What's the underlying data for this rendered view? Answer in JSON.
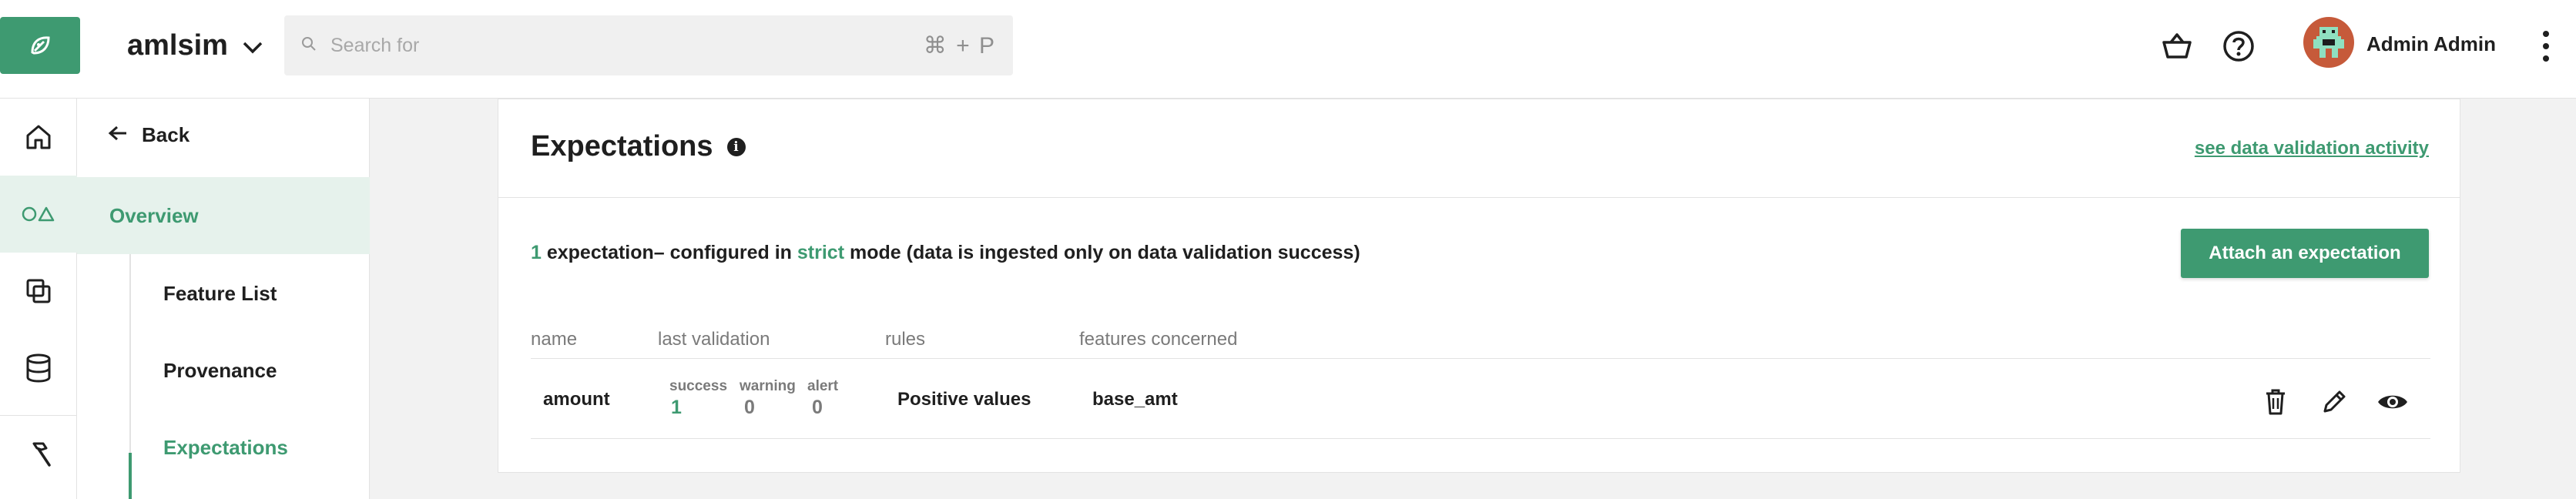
{
  "header": {
    "project_name": "amlsim",
    "search_placeholder": "Search for",
    "search_shortcut": "⌘ + P",
    "user_name": "Admin Admin"
  },
  "subnav": {
    "back_label": "Back",
    "section": "Overview",
    "items": [
      {
        "label": "Feature List",
        "active": false
      },
      {
        "label": "Provenance",
        "active": false
      },
      {
        "label": "Expectations",
        "active": true
      }
    ]
  },
  "panel": {
    "title": "Expectations",
    "activity_link": "see data validation activity",
    "summary": {
      "count": "1",
      "text_a": " expectation– configured in ",
      "mode": "strict",
      "text_b": " mode (data is ingested only on data validation success)"
    },
    "attach_button": "Attach an expectation",
    "columns": [
      "name",
      "last validation",
      "rules",
      "features concerned"
    ],
    "rows": [
      {
        "name": "amount",
        "validation": {
          "success_label": "success",
          "success": "1",
          "warning_label": "warning",
          "warning": "0",
          "alert_label": "alert",
          "alert": "0"
        },
        "rules": "Positive values",
        "features": "base_amt"
      }
    ]
  },
  "colors": {
    "accent": "#3e9a71",
    "accent_light": "#e6f2ec",
    "text": "#1f1f1f",
    "muted": "#7a7a7a"
  },
  "icons": [
    "logo-icon",
    "chevron-down-icon",
    "search-icon",
    "basket-icon",
    "help-icon",
    "avatar-icon",
    "kebab-menu-icon",
    "home-icon",
    "shapes-icon",
    "layers-icon",
    "database-icon",
    "hammer-icon",
    "arrow-left-icon",
    "info-icon",
    "trash-icon",
    "pencil-icon",
    "eye-icon"
  ]
}
